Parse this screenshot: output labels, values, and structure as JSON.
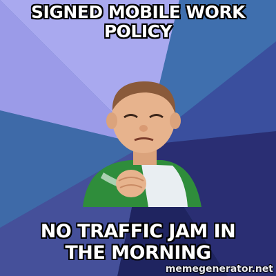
{
  "meme": {
    "top_text": "SIGNED MOBILE WORK POLICY",
    "bottom_text": "NO TRAFFIC JAM IN THE MORNING",
    "watermark": "memegenerator.net"
  },
  "colors": {
    "ray_light": "#a9a9ef",
    "ray_light_2": "#9b9be8",
    "ray_mid": "#3e6aa8",
    "ray_mid_2": "#45509a",
    "ray_dark": "#2a2e73",
    "ray_dark_2": "#1f2460",
    "shirt_green": "#2f8d3b",
    "skin": "#e7b38d"
  },
  "icons": {
    "subject": "success-kid-illustration"
  }
}
